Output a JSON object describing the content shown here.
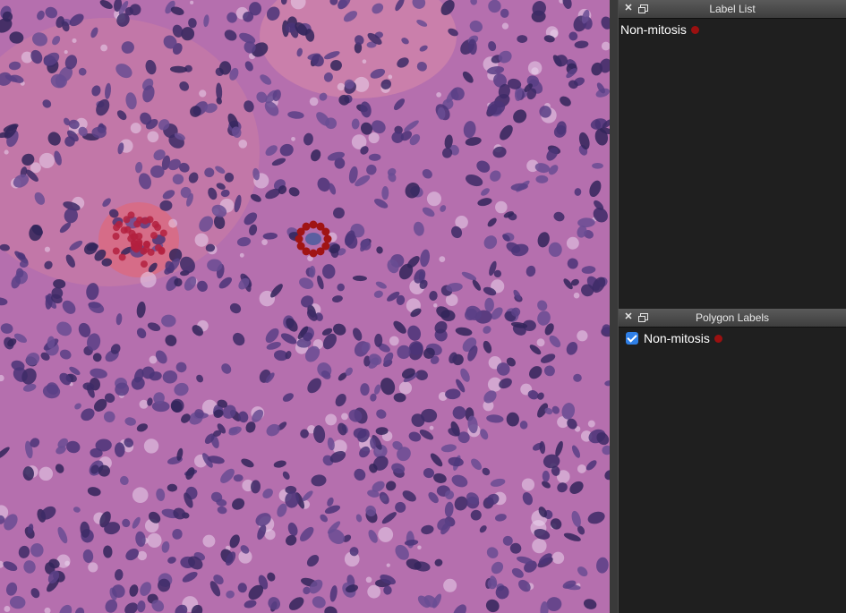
{
  "canvas": {
    "image_desc_hidden": "",
    "annotation_color": "#a01414"
  },
  "label_list_panel": {
    "title": "Label List",
    "items": [
      {
        "label": "Non-mitosis",
        "color": "#9b1010"
      }
    ]
  },
  "polygon_labels_panel": {
    "title": "Polygon Labels",
    "items": [
      {
        "label": "Non-mitosis",
        "checked": true,
        "color": "#9b1010"
      }
    ]
  }
}
